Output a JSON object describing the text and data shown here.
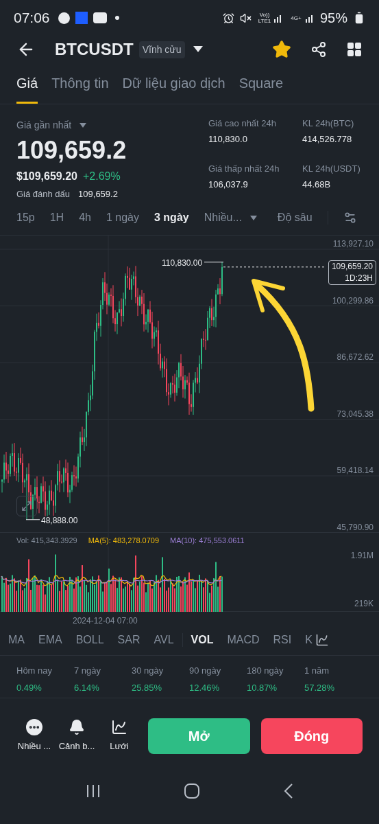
{
  "status_bar": {
    "time": "07:06",
    "network_labels": [
      "Vo)) LTE1",
      "4G+"
    ],
    "battery": "95%"
  },
  "header": {
    "symbol": "BTCUSDT",
    "contract_tag": "Vĩnh cửu",
    "favorite": true
  },
  "tabs": [
    {
      "label": "Giá",
      "selected": true
    },
    {
      "label": "Thông tin",
      "selected": false
    },
    {
      "label": "Dữ liệu giao dịch",
      "selected": false
    },
    {
      "label": "Square",
      "selected": false
    }
  ],
  "price": {
    "label": "Giá gần nhất",
    "last": "109,659.2",
    "usd": "$109,659.20",
    "change": "+2.69%",
    "mark_label": "Giá đánh dấu",
    "mark": "109,659.2"
  },
  "stats": [
    {
      "label": "Giá cao nhất 24h",
      "value": "110,830.0"
    },
    {
      "label": "KL 24h(BTC)",
      "value": "414,526.778"
    },
    {
      "label": "Giá thấp nhất 24h",
      "value": "106,037.9"
    },
    {
      "label": "KL 24h(USDT)",
      "value": "44.68B"
    }
  ],
  "intervals": [
    {
      "label": "15p",
      "selected": false
    },
    {
      "label": "1H",
      "selected": false
    },
    {
      "label": "4h",
      "selected": false
    },
    {
      "label": "1 ngày",
      "selected": false
    },
    {
      "label": "3 ngày",
      "selected": true
    }
  ],
  "more_intervals": "Nhiều...",
  "depth": "Độ sâu",
  "chart": {
    "price_axis": [
      "113,927.10",
      "100,299.86",
      "86,672.62",
      "73,045.38",
      "59,418.14",
      "45,790.90"
    ],
    "high_label": "110,830.00",
    "low_label": "48,888.00",
    "current_price": "109,659.20",
    "countdown": "1D:23H"
  },
  "volume": {
    "vol": "Vol: 415,343.3929",
    "ma5": "MA(5): 483,278.0709",
    "ma10": "MA(10): 475,553.0611",
    "max_label": "1.91M",
    "min_label": "219K",
    "date_label": "2024-12-04 07:00"
  },
  "indicators": [
    {
      "label": "MA",
      "selected": false
    },
    {
      "label": "EMA",
      "selected": false
    },
    {
      "label": "BOLL",
      "selected": false
    },
    {
      "label": "SAR",
      "selected": false
    },
    {
      "label": "AVL",
      "selected": false
    },
    {
      "label": "VOL",
      "selected": true
    },
    {
      "label": "MACD",
      "selected": false
    },
    {
      "label": "RSI",
      "selected": false
    },
    {
      "label": "K",
      "selected": false
    }
  ],
  "performance": [
    {
      "label": "Hôm nay",
      "value": "0.49%"
    },
    {
      "label": "7 ngày",
      "value": "6.14%"
    },
    {
      "label": "30 ngày",
      "value": "25.85%"
    },
    {
      "label": "90 ngày",
      "value": "12.46%"
    },
    {
      "label": "180 ngày",
      "value": "10.87%"
    },
    {
      "label": "1 năm",
      "value": "57.28%"
    }
  ],
  "actions": [
    {
      "label": "Nhiều ...",
      "kind": "more"
    },
    {
      "label": "Cảnh b...",
      "kind": "alert"
    },
    {
      "label": "Lưới",
      "kind": "grid"
    }
  ],
  "buttons": [
    {
      "label": "Mở",
      "kind": "open"
    },
    {
      "label": "Đóng",
      "kind": "close"
    }
  ]
}
